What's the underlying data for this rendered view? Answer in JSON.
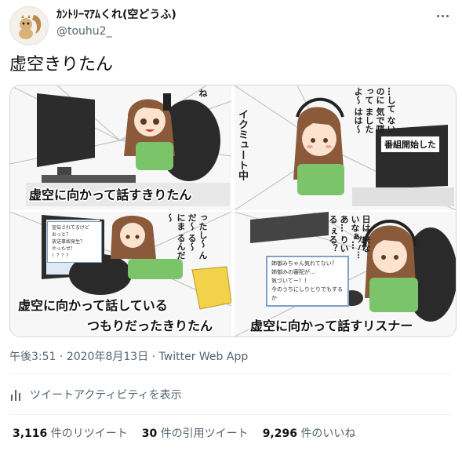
{
  "tweet": {
    "display_name": "ｶﾝﾄﾘｰﾏｱﾑくれ(空どうふ)",
    "handle": "@touhu2_",
    "text": "虚空きりたん",
    "meta": {
      "time": "午後3:51",
      "date": "2020年8月13日",
      "separator": "·",
      "app": "Twitter Web App"
    },
    "activity_label": "ツイートアクティビティを表示",
    "stats": [
      {
        "count": "3,116",
        "label": "件のリツイート"
      },
      {
        "count": "30",
        "label": "件の引用ツイート"
      },
      {
        "count": "9,296",
        "label": "件のいいね"
      }
    ]
  },
  "comic": {
    "panel1": {
      "caption": "虚空に向かって話すきりたん",
      "speech": "ね"
    },
    "panel2": {
      "side_text": "イクミュート中",
      "speech": "…して ないのに 気で喋って ましたよ～ はは～",
      "sign": "番組開始した"
    },
    "panel3": {
      "caption_line1": "虚空に向かって話している",
      "caption_line2": "つもりだったきりたん",
      "speech": "ったし～ んだ～ る～ にま るんだ～",
      "screen_lines": [
        "宣伝されてるけど",
        "おっと？",
        "放送事故発生？",
        "やったぜ！",
        "！？？？"
      ]
    },
    "panel4": {
      "caption": "虚空に向かって話すリスナー",
      "speech": "日は 来ないなぁ… あ… りいる ぇる？",
      "ellipsis": "カハ…",
      "chat_lines": [
        "姉御みちゃん気れてない？",
        "姉御みの審配が…",
        "気づいてー！！",
        "今のうちにしりとりでもするか"
      ]
    }
  },
  "colors": {
    "text": "#0f1419",
    "muted": "#536471",
    "border": "#cfd9de",
    "hair": "#8a5a3a",
    "shirt": "#7cc46a"
  }
}
